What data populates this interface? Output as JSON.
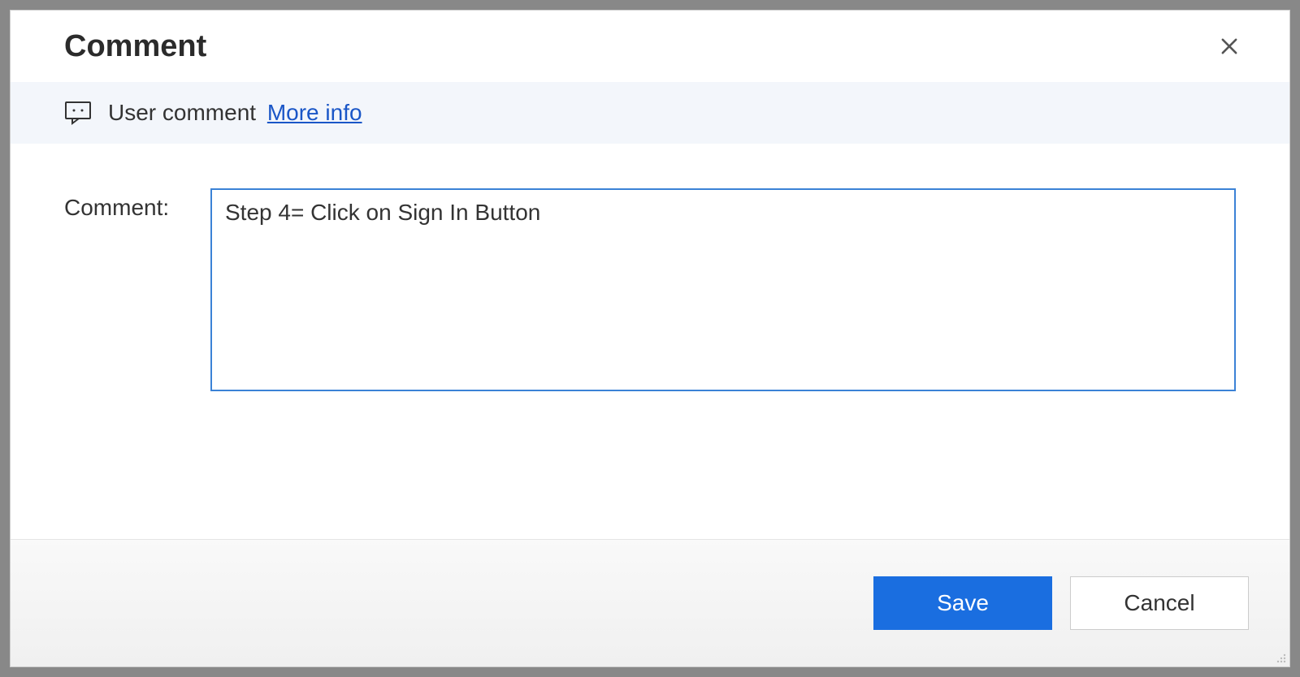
{
  "dialog": {
    "title": "Comment",
    "info_bar": {
      "label": "User comment",
      "more_info_label": "More info"
    },
    "form": {
      "field_label": "Comment:",
      "comment_value": "Step 4= Click on Sign In Button"
    },
    "buttons": {
      "save_label": "Save",
      "cancel_label": "Cancel"
    }
  }
}
